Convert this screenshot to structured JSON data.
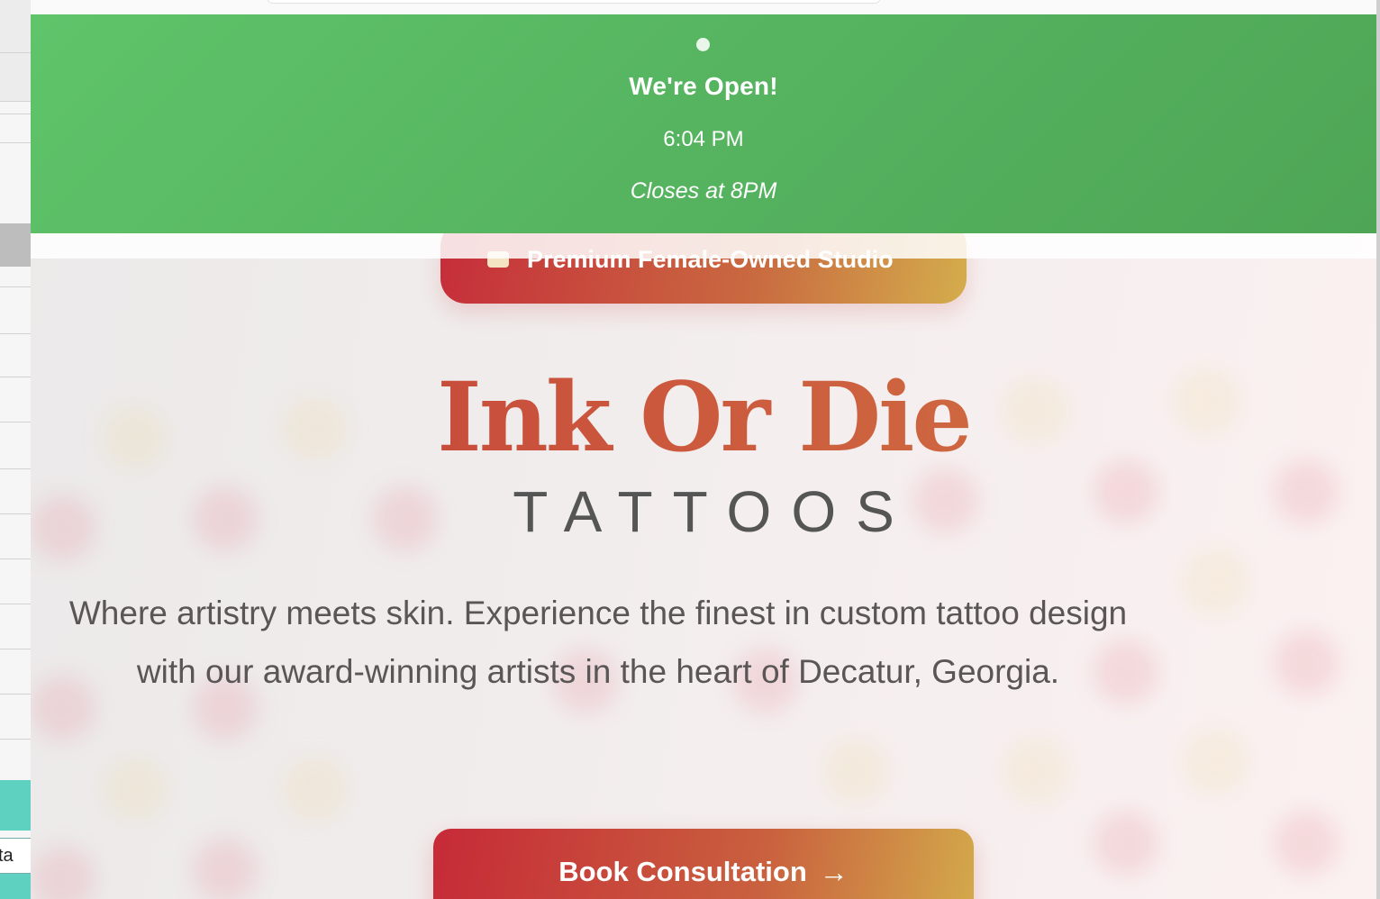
{
  "background_app": {
    "cell_text": "ta"
  },
  "status_banner": {
    "title": "We're Open!",
    "time": "6:04 PM",
    "closes": "Closes at 8PM",
    "color": "#55b25f"
  },
  "badge": {
    "label": "Premium Female-Owned Studio",
    "icon": "gift-icon"
  },
  "hero": {
    "title": "Ink Or Die",
    "subtitle": "TATTOOS",
    "description": "Where artistry meets skin. Experience the finest in custom tattoo design with our award-winning artists in the heart of Decatur, Georgia."
  },
  "cta": {
    "label": "Book Consultation",
    "arrow": "→",
    "icon": "arrow-right-icon"
  },
  "colors": {
    "brand_red": "#c62a37",
    "brand_gold": "#d3aa4b",
    "open_green": "#5fc46a"
  }
}
